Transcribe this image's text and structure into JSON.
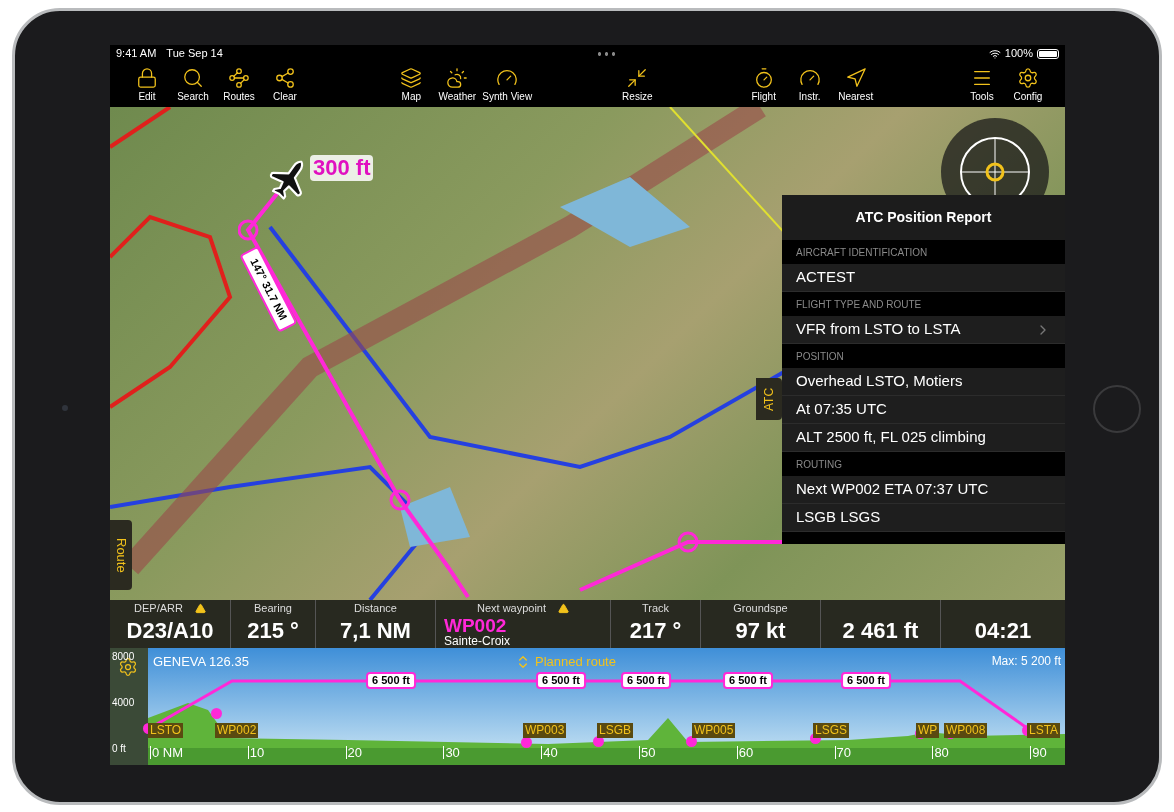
{
  "status_bar": {
    "time": "9:41 AM",
    "date": "Tue Sep 14",
    "battery": "100%"
  },
  "toolbar": [
    {
      "label": "Edit"
    },
    {
      "label": "Search"
    },
    {
      "label": "Routes"
    },
    {
      "label": "Clear"
    },
    {
      "label": "Map"
    },
    {
      "label": "Weather"
    },
    {
      "label": "Synth View"
    },
    {
      "label": "Resize"
    },
    {
      "label": "Flight"
    },
    {
      "label": "Instr."
    },
    {
      "label": "Nearest"
    },
    {
      "label": "Tools"
    },
    {
      "label": "Config"
    }
  ],
  "map": {
    "altitude_label": "300 ft",
    "leg_label": "147° 31.7 NM",
    "side_tab": "Route",
    "panel_tab": "ATC"
  },
  "atc_panel": {
    "title": "ATC Position Report",
    "sections": [
      {
        "header": "AIRCRAFT IDENTIFICATION",
        "rows": [
          {
            "text": "ACTEST",
            "kind": "plain"
          }
        ]
      },
      {
        "header": "FLIGHT TYPE AND ROUTE",
        "rows": [
          {
            "text": "VFR from LSTO to LSTA",
            "kind": "disclosure"
          }
        ]
      },
      {
        "header": "POSITION",
        "rows": [
          {
            "text": "Overhead LSTO, Motiers",
            "kind": "plain"
          },
          {
            "text": "At 07:35 UTC",
            "kind": "plain"
          },
          {
            "text": "ALT 2500 ft, FL 025 climbing",
            "kind": "plain"
          }
        ]
      },
      {
        "header": "ROUTING",
        "rows": [
          {
            "text": "Next WP002 ETA 07:37 UTC",
            "kind": "plain"
          },
          {
            "text": "LSGB LSGS",
            "kind": "plain"
          }
        ]
      }
    ]
  },
  "info_bar": [
    {
      "label": "DEP/ARR",
      "value": "D23/A10",
      "warning": true
    },
    {
      "label": "Bearing",
      "value": "215 °",
      "warning": false
    },
    {
      "label": "Distance",
      "value": "7,1 NM",
      "warning": false
    },
    {
      "label": "Next waypoint",
      "value": "WP002",
      "sub": "Sainte-Croix",
      "warning": true
    },
    {
      "label": "Track",
      "value": "217 °",
      "warning": false
    },
    {
      "label": "Groundspe",
      "value": "97 kt",
      "warning": false
    },
    {
      "value": "2 461 ft",
      "warning": false
    },
    {
      "value": "04:21",
      "warning": false
    }
  ],
  "profile": {
    "frequency": "GENEVA 126.35",
    "mode": "Planned route",
    "max": "Max: 5 200 ft",
    "y_labels": [
      "8000",
      "4000",
      "0 ft"
    ],
    "x_labels": [
      "0 NM",
      "10",
      "20",
      "30",
      "40",
      "50",
      "60",
      "70",
      "80",
      "90"
    ],
    "altitudes": [
      "6 500 ft",
      "6 500 ft",
      "6 500 ft",
      "6 500 ft",
      "6 500 ft"
    ],
    "waypoints": [
      "LSTO",
      "WP002",
      "WP003",
      "LSGB",
      "WP005",
      "LSGS",
      "WP",
      "WP008",
      "LSTA"
    ]
  }
}
